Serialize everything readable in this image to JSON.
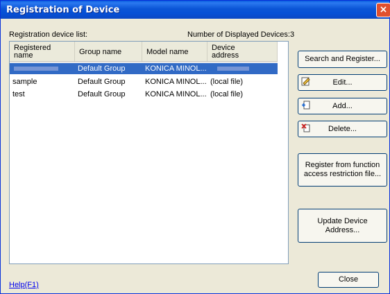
{
  "window": {
    "title": "Registration of Device",
    "close_glyph": "×"
  },
  "labels": {
    "device_list": "Registration device list:",
    "count_prefix": "Number of Displayed Devices:",
    "count": "3"
  },
  "columns": {
    "registered_name": "Registered name",
    "group_name": "Group name",
    "model_name": "Model name",
    "device_address": "Device address"
  },
  "rows": [
    {
      "name": "",
      "group": "Default Group",
      "model": "KONICA MINOL...",
      "address": "",
      "selected": true
    },
    {
      "name": "sample",
      "group": "Default Group",
      "model": "KONICA MINOL...",
      "address": "(local file)",
      "selected": false
    },
    {
      "name": "test",
      "group": "Default Group",
      "model": "KONICA MINOL...",
      "address": "(local file)",
      "selected": false
    }
  ],
  "buttons": {
    "search_register": "Search and Register...",
    "edit": "Edit...",
    "add": "Add...",
    "delete": "Delete...",
    "register_from_file": "Register from function access restriction file...",
    "update_address": "Update Device Address...",
    "close": "Close"
  },
  "help_link": "Help(F1)",
  "icons": {
    "edit": "edit-icon",
    "add": "add-icon",
    "delete": "delete-icon"
  },
  "colors": {
    "title_bar": "#0a55d6",
    "selection": "#316ac5",
    "close_button": "#e0502f"
  }
}
